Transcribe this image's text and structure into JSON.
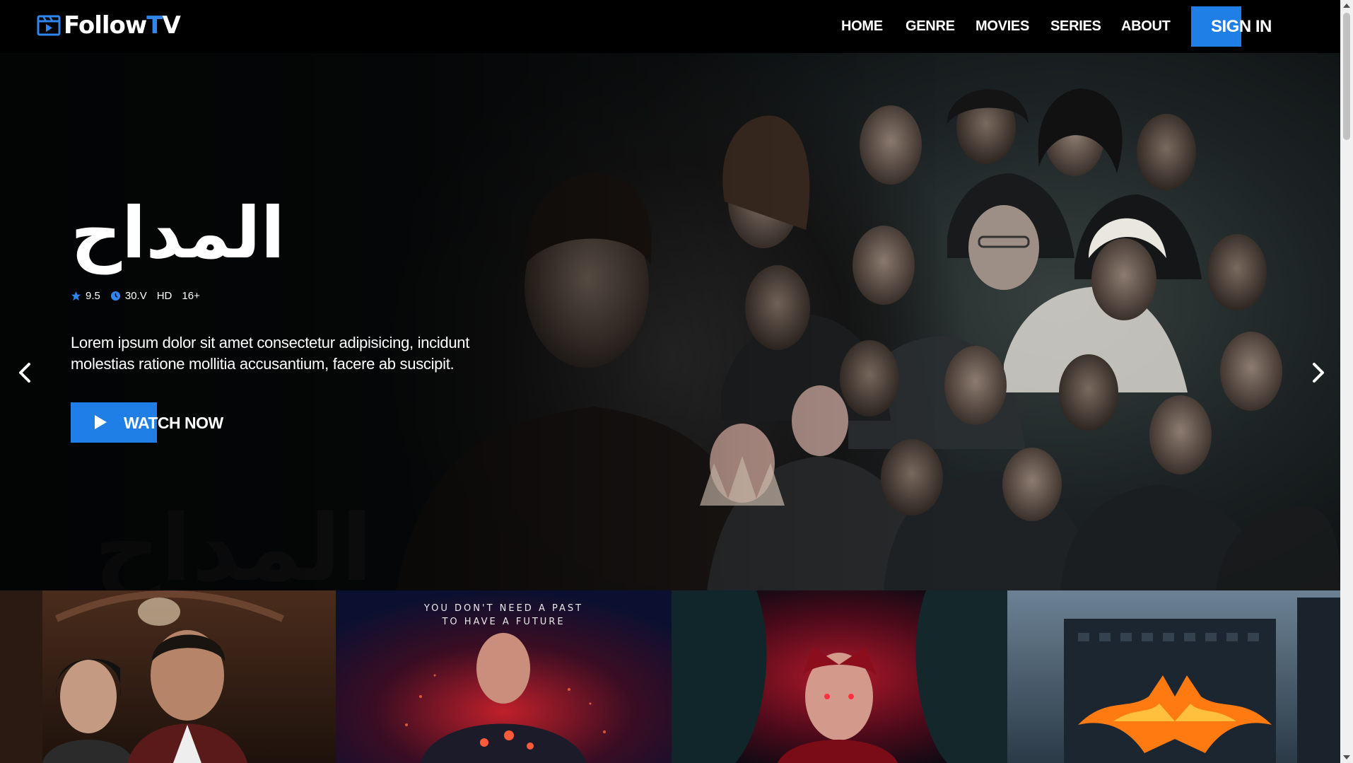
{
  "brand": {
    "name_part1": "Follow",
    "name_t": "T",
    "name_part2": "V",
    "accent": "#1f7fe6",
    "icon": "video-board-icon"
  },
  "nav": {
    "items": [
      {
        "label": "HOME"
      },
      {
        "label": "GENRE"
      },
      {
        "label": "MOVIES"
      },
      {
        "label": "SERIES"
      },
      {
        "label": "ABOUT"
      }
    ],
    "sign_in": "SIGN IN"
  },
  "hero": {
    "title": "المداح",
    "rating": "9.5",
    "episodes": "30.V",
    "quality": "HD",
    "age": "16+",
    "description": "Lorem ipsum dolor sit amet consectetur adipisicing, incidunt molestias ratione mollitia accusantium, facere ab suscipit.",
    "cta": "WATCH NOW",
    "icons": [
      "star-icon",
      "clock-icon",
      "play-icon",
      "chevron-left-icon",
      "chevron-right-icon"
    ]
  },
  "posters": {
    "items": [
      {
        "id": "drama-series"
      },
      {
        "id": "bloodshot",
        "tagline_line1": "YOU DON'T NEED A PAST",
        "tagline_line2": "TO HAVE A FUTURE"
      },
      {
        "id": "wandavision"
      },
      {
        "id": "dark-knight"
      }
    ]
  }
}
